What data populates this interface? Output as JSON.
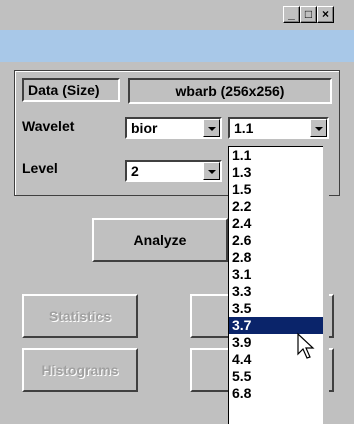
{
  "window": {
    "minimize_glyph": "_",
    "maximize_glyph": "□",
    "close_glyph": "×"
  },
  "form": {
    "data_label": "Data  (Size)",
    "data_value": "wbarb  (256x256)",
    "wavelet_label": "Wavelet",
    "wavelet_family": "bior",
    "wavelet_order": "1.1",
    "level_label": "Level",
    "level_value": "2"
  },
  "buttons": {
    "analyze": "Analyze",
    "statistics": "Statistics",
    "histograms": "Histograms",
    "partial_right_1": "C",
    "partial_right_2": ""
  },
  "dropdown": {
    "selected": "3.7",
    "options": [
      "1.1",
      "1.3",
      "1.5",
      "2.2",
      "2.4",
      "2.6",
      "2.8",
      "3.1",
      "3.3",
      "3.5",
      "3.7",
      "3.9",
      "4.4",
      "5.5",
      "6.8"
    ]
  },
  "colors": {
    "selection": "#0a246a",
    "band": "#a8c8e8",
    "face": "#c0c0c0"
  }
}
